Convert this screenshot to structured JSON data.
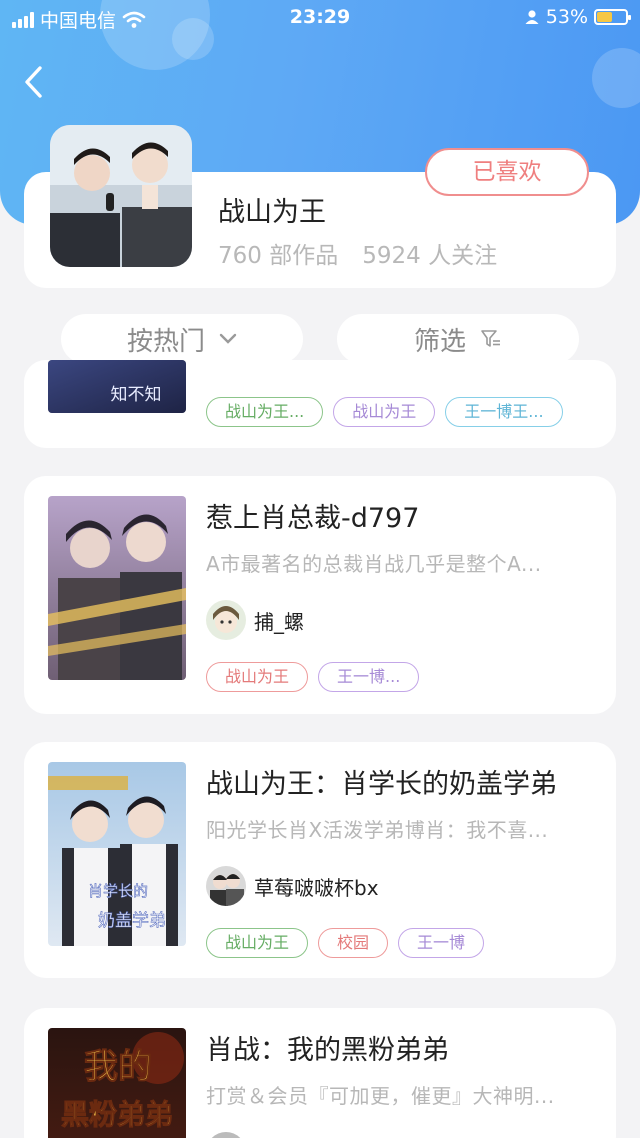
{
  "status_bar": {
    "carrier": "中国电信",
    "time": "23:29",
    "battery": "53%"
  },
  "profile": {
    "name": "战山为王",
    "works": "760 部作品",
    "followers": "5924 人关注",
    "liked_label": "已喜欢"
  },
  "filters": {
    "sort_label": "按热门",
    "filter_label": "筛选"
  },
  "books": [
    {
      "title": "",
      "desc": "",
      "author": "",
      "tags": [
        "战山为王...",
        "战山为王",
        "王一博王..."
      ]
    },
    {
      "title": "惹上肖总裁-d797",
      "desc": "A市最著名的总裁肖战几乎是整个A...",
      "author": "捕_螺",
      "tags": [
        "战山为王",
        "王一博..."
      ]
    },
    {
      "title": "战山为王：肖学长的奶盖学弟",
      "desc": "阳光学长肖X活泼学弟博肖：我不喜...",
      "author": "草莓啵啵杯bx",
      "tags": [
        "战山为王",
        "校园",
        "王一博"
      ]
    },
    {
      "title": "肖战：我的黑粉弟弟",
      "desc": "打赏＆会员『可加更，催更』大神明..."
    }
  ],
  "covers": {
    "book0_text": "知不知",
    "book2_text1": "肖学长的",
    "book2_text2": "奶盖学弟",
    "book3_text1": "我的",
    "book3_text2": "黑粉弟弟"
  },
  "colors": {
    "header": "#5ea9f5",
    "accent_red": "#ef7f7f"
  }
}
